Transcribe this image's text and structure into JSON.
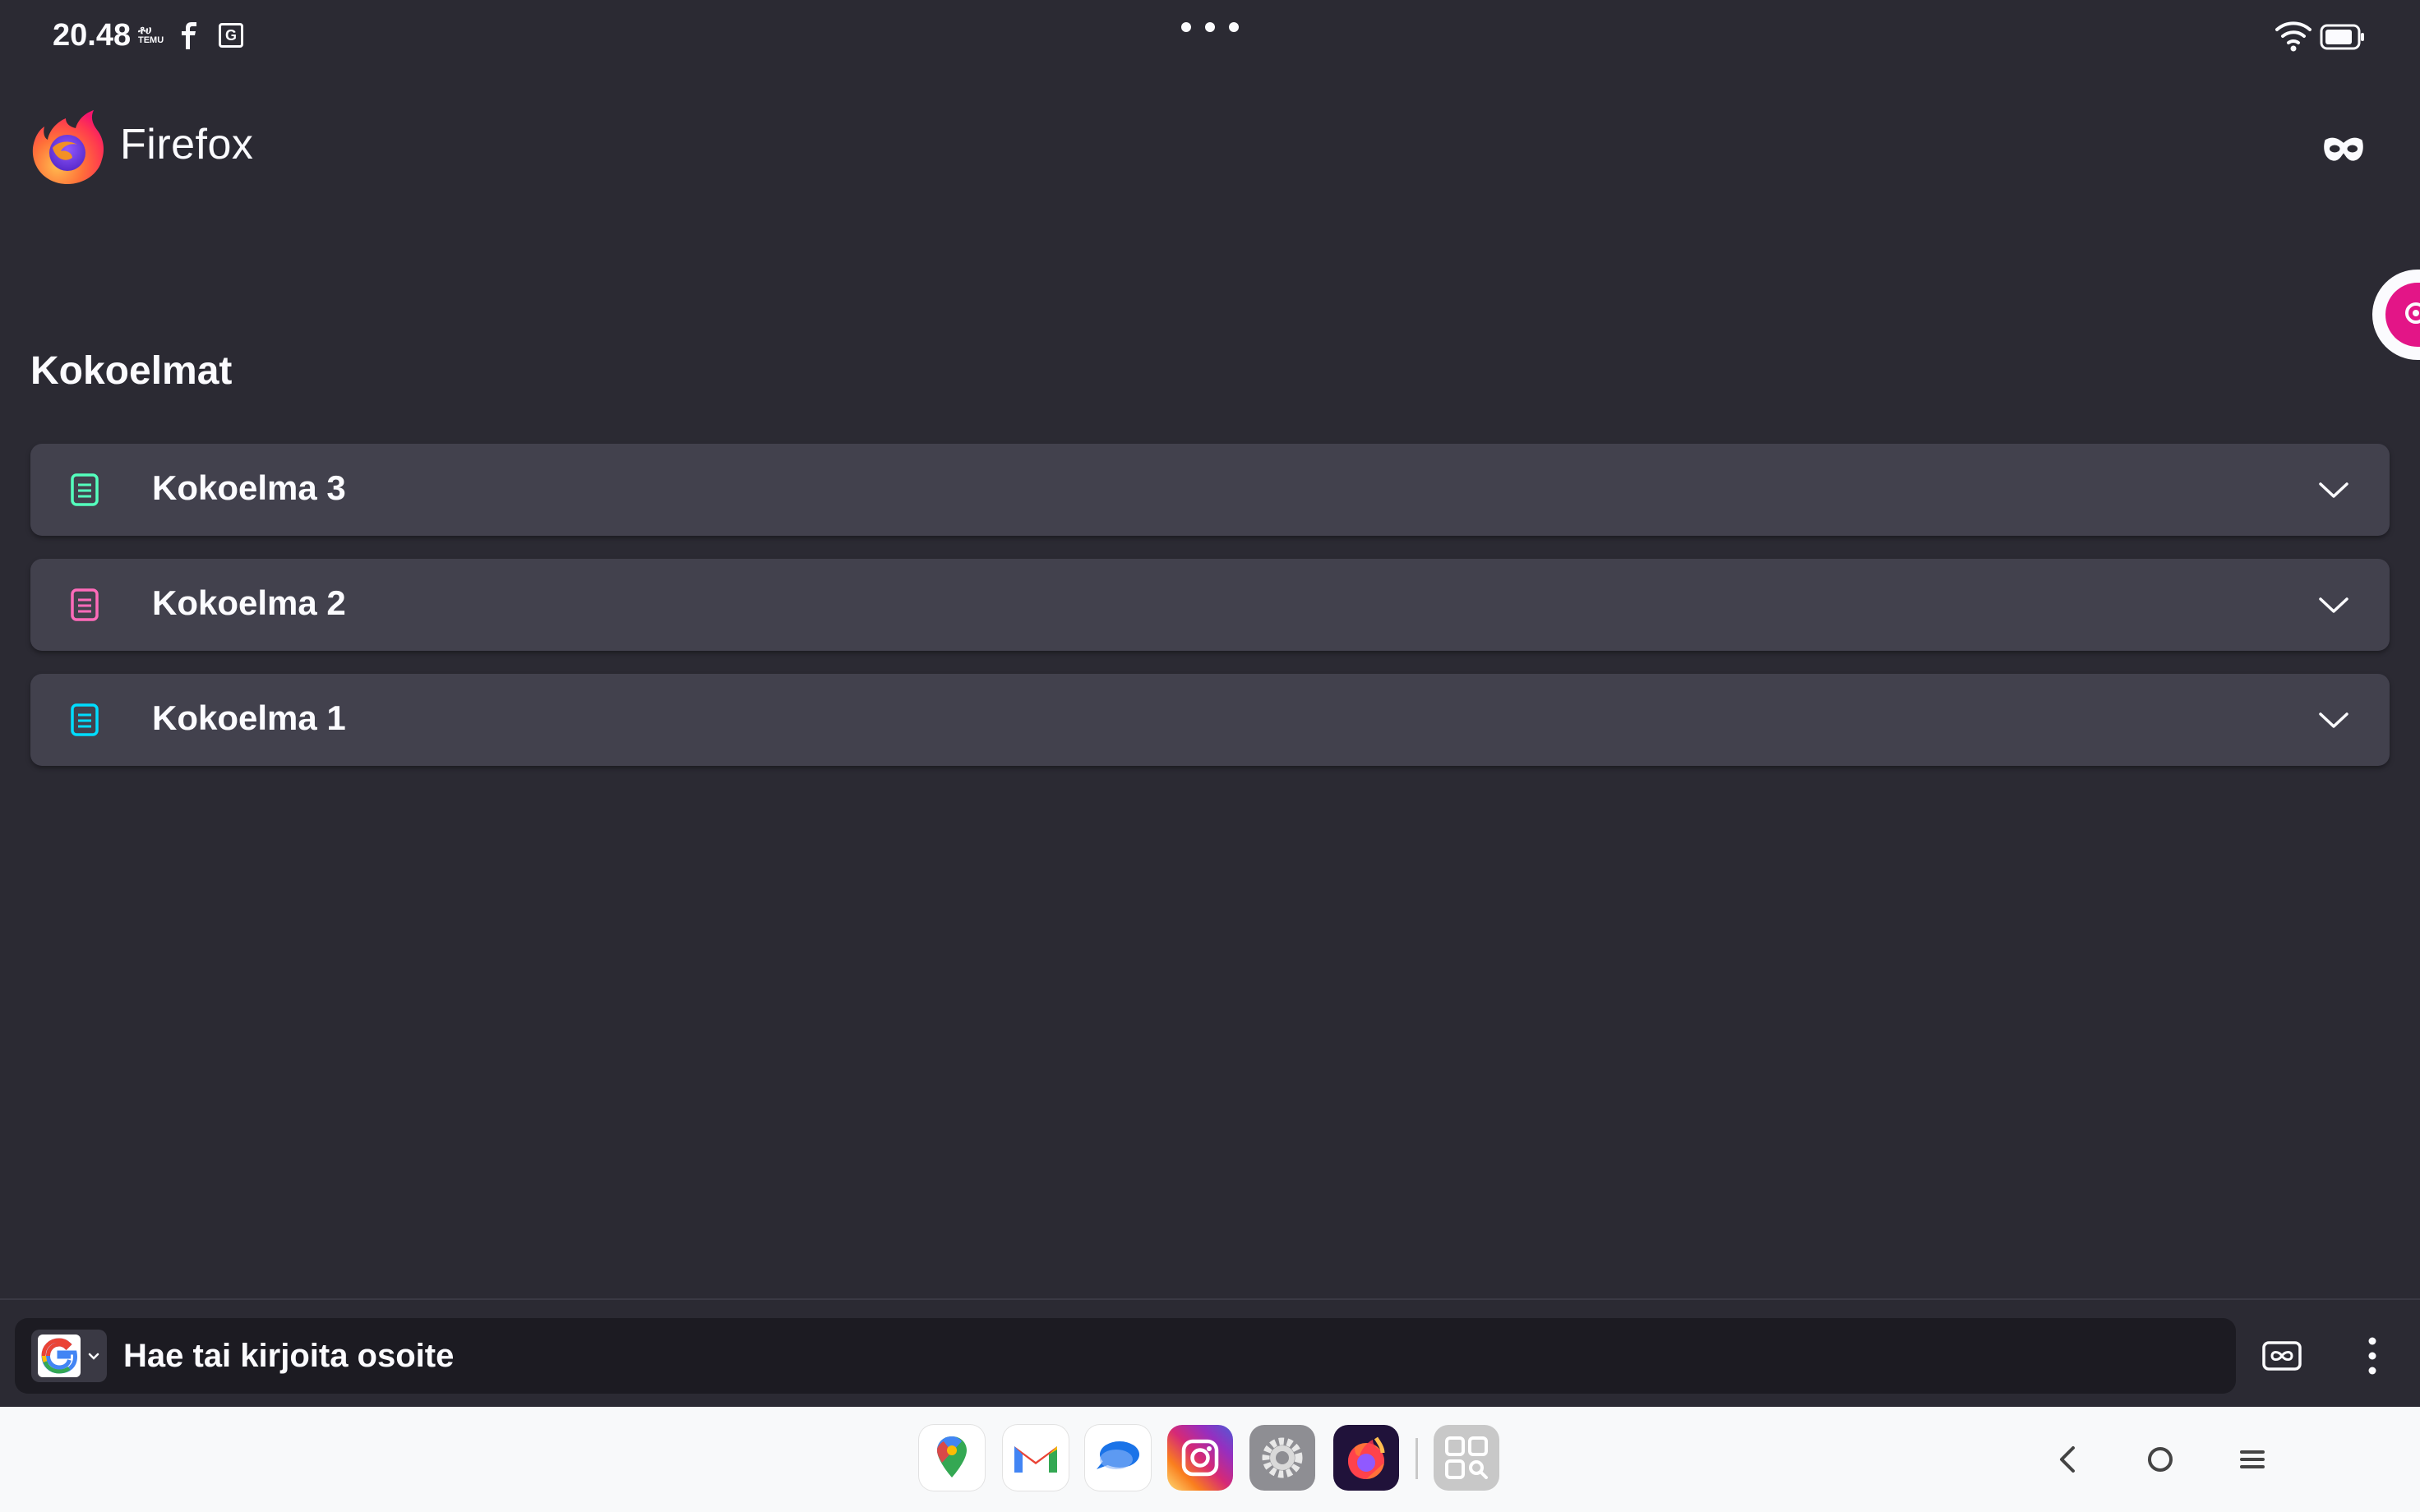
{
  "status_bar": {
    "time": "20.48",
    "small_icon_text_top": "ቶሀ",
    "small_icon_text_bottom": "TEMU",
    "translate_icon": "G",
    "icons": [
      "temu-icon",
      "facebook-icon",
      "translate-icon",
      "multiwindow-dots-icon",
      "wifi-icon",
      "battery-icon"
    ]
  },
  "header": {
    "brand": "Firefox",
    "private_mode_icon": "mask-icon"
  },
  "collections": {
    "title": "Kokoelmat",
    "items": [
      {
        "label": "Kokoelma 3",
        "color": "#54ffbd"
      },
      {
        "label": "Kokoelma 2",
        "color": "#ff6bba"
      },
      {
        "label": "Kokoelma 1",
        "color": "#00ddff"
      }
    ]
  },
  "toolbar": {
    "search_engine": "Google",
    "url_placeholder": "Hae tai kirjoita osoite",
    "tabs_icon": "tabs-icon",
    "menu_icon": "kebab-menu-icon"
  },
  "dock": {
    "apps": [
      "Maps",
      "Gmail",
      "Messages",
      "Instagram",
      "Settings",
      "Firefox",
      "App Library"
    ]
  },
  "nav": {
    "buttons": [
      "back-icon",
      "home-icon",
      "recents-icon"
    ]
  },
  "colors": {
    "background": "#2b2a33",
    "card": "#42414d",
    "urlbar": "#1c1b22",
    "accent_pink": "#e31587"
  }
}
